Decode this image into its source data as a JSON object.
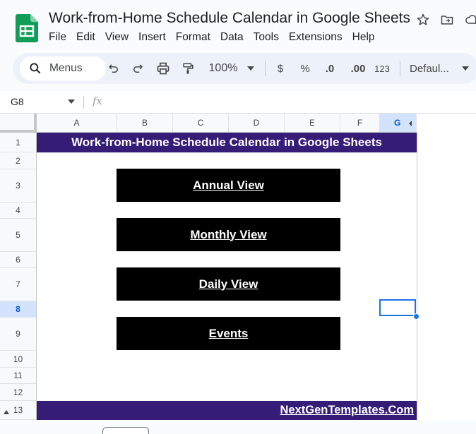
{
  "app": {
    "doc_title": "Work-from-Home Schedule Calendar in Google Sheets",
    "logo_icon": "google-sheets-logo",
    "title_icons": [
      "star-icon",
      "move-to-folder-icon",
      "cloud-status-icon"
    ],
    "brand_color": "#0f9d58"
  },
  "menu": [
    "File",
    "Edit",
    "View",
    "Insert",
    "Format",
    "Data",
    "Tools",
    "Extensions",
    "Help"
  ],
  "toolbar": {
    "search_label": "Menus",
    "zoom": "100%",
    "currency": "$",
    "percent": "%",
    "decrease_decimal": ".0",
    "increase_decimal": ".00",
    "number_format": "123",
    "font": "Defaul..."
  },
  "formula_bar": {
    "cell_ref": "G8",
    "fx": "fx",
    "value": ""
  },
  "grid": {
    "columns": [
      "A",
      "B",
      "C",
      "D",
      "E",
      "F",
      "G"
    ],
    "rows": [
      "1",
      "2",
      "3",
      "4",
      "5",
      "6",
      "7",
      "8",
      "9",
      "10",
      "11",
      "12",
      "13"
    ],
    "selected_column": "G",
    "selected_row": "8",
    "selected_cell": "G8"
  },
  "sheet": {
    "banner_title": "Work-from-Home Schedule Calendar in Google Sheets",
    "banner_color": "#341c77",
    "buttons": [
      {
        "label": "Annual View"
      },
      {
        "label": "Monthly View"
      },
      {
        "label": "Daily View"
      },
      {
        "label": "Events"
      }
    ],
    "footer_link": "NextGenTemplates.Com"
  }
}
